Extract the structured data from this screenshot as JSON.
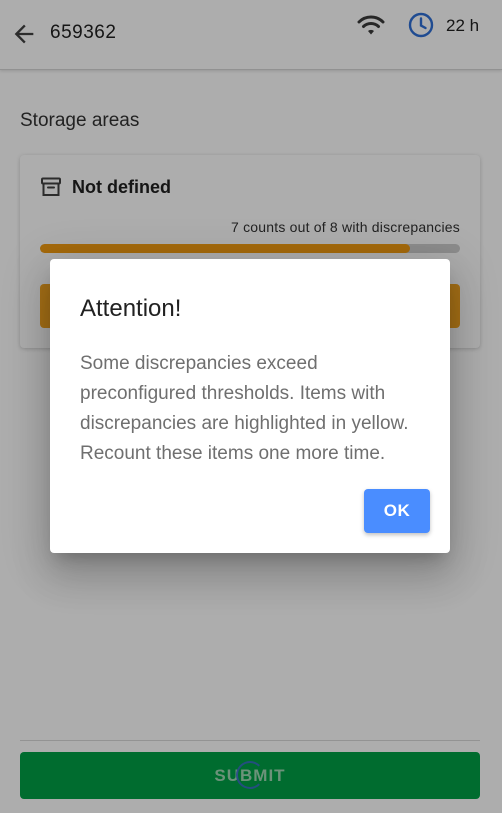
{
  "app_bar": {
    "title": "659362",
    "back_icon": "arrow-left-icon",
    "wifi_icon": "wifi-icon",
    "clock_icon": "clock-icon",
    "time_left": "22 h"
  },
  "content": {
    "section_title": "Storage areas",
    "card": {
      "icon": "archive-box-icon",
      "title": "Not defined",
      "status": "7 counts out of 8 with discrepancies",
      "progress_fraction": 0.88
    }
  },
  "bottom": {
    "submit_label": "SUBMIT"
  },
  "dialog": {
    "title": "Attention!",
    "body": "Some discrepancies exceed preconfigured thresholds. Items with discrepancies are highlighted in yellow. Recount these items one more time.",
    "ok_label": "OK"
  },
  "colors": {
    "accent": "#4a8dff",
    "submit": "#00a046",
    "progress": "#f39c12",
    "card_button": "#f5a623",
    "clock": "#2f6fd6"
  }
}
